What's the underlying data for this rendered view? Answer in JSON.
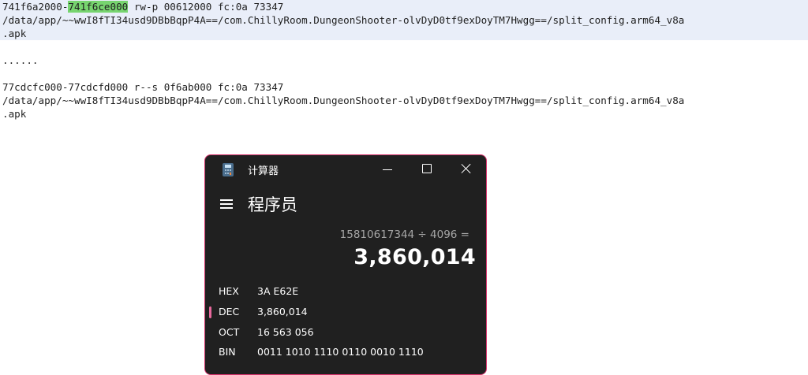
{
  "viewer": {
    "line1_addr_start": "741f6a2000-",
    "line1_addr_end_highlighted": "741f6ce000",
    "line1_rest": " rw-p 00612000 fc:0a 73347",
    "line2": "/data/app/~~wwI8fTI34usd9DBbBqpP4A==/com.ChillyRoom.DungeonShooter-olvDyD0tf9exDoyTM7Hwgg==/split_config.arm64_v8a",
    "line3": ".apk",
    "ellipsis": "......",
    "line5": "77cdcfc000-77cdcfd000 r--s 0f6ab000 fc:0a 73347",
    "line6": "/data/app/~~wwI8fTI34usd9DBbBqpP4A==/com.ChillyRoom.DungeonShooter-olvDyD0tf9exDoyTM7Hwgg==/split_config.arm64_v8a",
    "line7": ".apk",
    "highlight_color": "#77d46f",
    "selected_band_color": "#e9eef9"
  },
  "calculator": {
    "window_title": "计算器",
    "app_icon": "calculator-icon",
    "mode": "程序员",
    "expression": "15810617344 ÷ 4096 =",
    "result": "3,860,014",
    "bases": [
      {
        "label": "HEX",
        "value": "3A E62E",
        "selected": false
      },
      {
        "label": "DEC",
        "value": "3,860,014",
        "selected": true
      },
      {
        "label": "OCT",
        "value": "16 563 056",
        "selected": false
      },
      {
        "label": "BIN",
        "value": "0011 1010 1110 0110 0010 1110",
        "selected": false
      }
    ],
    "accent_color": "#e8689c",
    "border_color": "#d6336c",
    "background_color": "#202020"
  }
}
